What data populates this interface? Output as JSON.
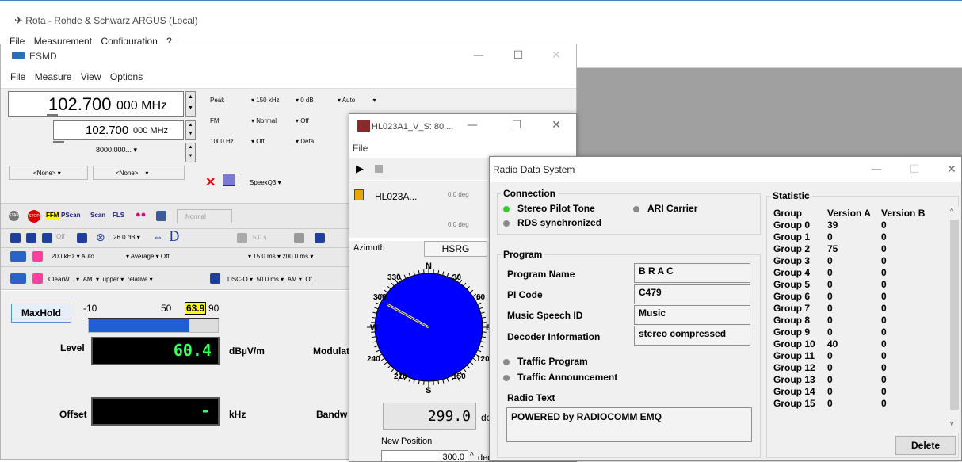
{
  "main_window": {
    "title": "Rota - Rohde & Schwarz ARGUS (Local)",
    "menu": [
      "File",
      "Measurement",
      "Configuration",
      "?"
    ]
  },
  "esmd": {
    "title": "ESMD",
    "menu": [
      "File",
      "Measure",
      "View",
      "Options"
    ],
    "freq_main": "102.700",
    "freq_main_small": "000 MHz",
    "freq_sub": "102.700",
    "freq_sub_small": "000 MHz",
    "span_value": "8000.000...",
    "none1": "<None>",
    "none2": "<None>",
    "speex": "SpeexQ3",
    "combos": {
      "detector": "Peak",
      "bw": "150 kHz",
      "atten": "0 dB",
      "auto": "Auto",
      "demod": "FM",
      "mode": "Normal",
      "off1": "Off",
      "step": "1000 Hz",
      "off2": "Off",
      "def": "Defa"
    },
    "toolbar1": {
      "ffm": "FFM",
      "pscan": "PScan",
      "scan": "Scan",
      "fls": "FLS",
      "normal": "Normal",
      "start": "START",
      "stop": "STOP"
    },
    "toolbar2": {
      "off": "Off",
      "level": "26.0 dB",
      "time": "5.0 s"
    },
    "toolbar3": {
      "bw": "200 kHz",
      "auto": "Auto",
      "average": "Average",
      "off": "Off",
      "t1": "15.0 ms",
      "t2": "200.0 ms"
    },
    "toolbar4": {
      "clearw": "ClearW...",
      "am": "AM",
      "upper": "upper",
      "relative": "relative",
      "dsc": "DSC-O",
      "t": "50.0 ms",
      "am2": "AM",
      "of": "Of"
    },
    "maxhold": "MaxHold",
    "scale": [
      "-10",
      "50",
      "90"
    ],
    "scale_marker": "63.9",
    "level_fraction": 0.78,
    "level_label": "Level",
    "level_value": "60.4",
    "level_unit": "dBµV/m",
    "offset_label": "Offset",
    "offset_value": "-",
    "offset_unit": "kHz",
    "modulat_label": "Modulat",
    "bandw_label": "Bandw"
  },
  "hl_window": {
    "title": "HL023A1_V_S: 80....",
    "menu": "File",
    "list_item": "HL023A...",
    "deg1": "0.0 deg",
    "deg2": "0.0 deg",
    "tab_azimuth": "Azimuth",
    "tab_hsrg": "HSRG",
    "compass_labels": {
      "n": "N",
      "s": "S",
      "e": "E",
      "w": "W",
      "d330": "330",
      "d30": "30",
      "d300": "300",
      "d60": "60",
      "d240": "240",
      "d120": "120",
      "d210": "210",
      "d150": "150"
    },
    "needle_deg": 299,
    "bearing": "299.0",
    "bearing_unit": "deg",
    "new_position_label": "New Position",
    "new_position_value": "300.0",
    "new_position_unit": "deg"
  },
  "rds": {
    "title": "Radio Data System",
    "connection_legend": "Connection",
    "stereo_pilot": "Stereo Pilot Tone",
    "ari_carrier": "ARI Carrier",
    "rds_sync": "RDS synchronized",
    "program_legend": "Program",
    "program_name_label": "Program Name",
    "program_name": "B R A C",
    "pi_code_label": "PI Code",
    "pi_code": "C479",
    "msid_label": "Music Speech ID",
    "msid": "Music",
    "decoder_label": "Decoder Information",
    "decoder": "stereo compressed",
    "traffic_program": "Traffic Program",
    "traffic_announcement": "Traffic Announcement",
    "radio_text_label": "Radio Text",
    "radio_text": "POWERED by RADIOCOMM EMQ",
    "statistic_legend": "Statistic",
    "col_group": "Group",
    "col_a": "Version A",
    "col_b": "Version B",
    "rows": [
      {
        "g": "Group 0",
        "a": "39",
        "b": "0"
      },
      {
        "g": "Group 1",
        "a": "0",
        "b": "0"
      },
      {
        "g": "Group 2",
        "a": "75",
        "b": "0"
      },
      {
        "g": "Group 3",
        "a": "0",
        "b": "0"
      },
      {
        "g": "Group 4",
        "a": "0",
        "b": "0"
      },
      {
        "g": "Group 5",
        "a": "0",
        "b": "0"
      },
      {
        "g": "Group 6",
        "a": "0",
        "b": "0"
      },
      {
        "g": "Group 7",
        "a": "0",
        "b": "0"
      },
      {
        "g": "Group 8",
        "a": "0",
        "b": "0"
      },
      {
        "g": "Group 9",
        "a": "0",
        "b": "0"
      },
      {
        "g": "Group 10",
        "a": "40",
        "b": "0"
      },
      {
        "g": "Group 11",
        "a": "0",
        "b": "0"
      },
      {
        "g": "Group 12",
        "a": "0",
        "b": "0"
      },
      {
        "g": "Group 13",
        "a": "0",
        "b": "0"
      },
      {
        "g": "Group 14",
        "a": "0",
        "b": "0"
      },
      {
        "g": "Group 15",
        "a": "0",
        "b": "0"
      }
    ],
    "delete": "Delete"
  },
  "colors": {
    "lcd_text": "#3bff5a",
    "compass_fill": "#0000ff",
    "level_bar": "#1f5fd6",
    "marker": "#ffff00"
  }
}
